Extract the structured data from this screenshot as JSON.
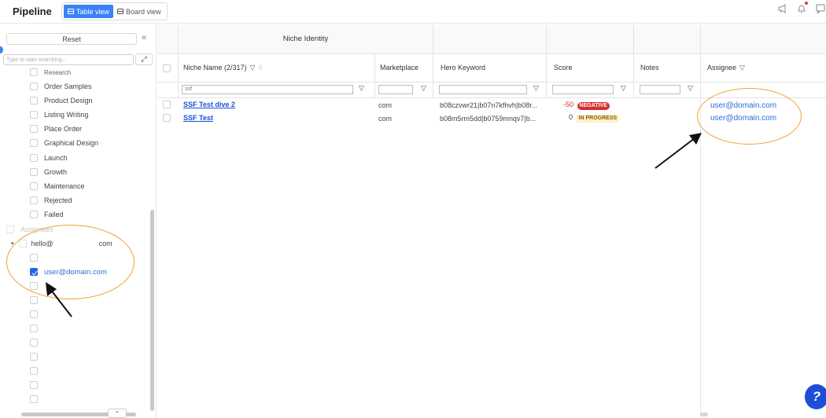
{
  "header": {
    "title": "Pipeline",
    "views": [
      {
        "label": "Table view",
        "active": true,
        "icon": "table-icon"
      },
      {
        "label": "Board view",
        "active": false,
        "icon": "board-icon"
      }
    ],
    "icons": [
      "megaphone-icon",
      "bell-icon",
      "chat-icon"
    ]
  },
  "sidebar": {
    "reset_label": "Reset",
    "collapse_glyph": "«",
    "search_placeholder": "Type to start searching...",
    "expand_glyph": "⤢",
    "stages": [
      {
        "label": "Research",
        "checked": false,
        "partial": true
      },
      {
        "label": "Order Samples",
        "checked": false
      },
      {
        "label": "Product Design",
        "checked": false
      },
      {
        "label": "Listing Writing",
        "checked": false
      },
      {
        "label": "Place Order",
        "checked": false
      },
      {
        "label": "Graphical Design",
        "checked": false
      },
      {
        "label": "Launch",
        "checked": false
      },
      {
        "label": "Growth",
        "checked": false
      },
      {
        "label": "Maintenance",
        "checked": false
      },
      {
        "label": "Rejected",
        "checked": false
      },
      {
        "label": "Failed",
        "checked": false
      }
    ],
    "assignees_label": "Assignees",
    "assignee_group": {
      "label_prefix": "hello@",
      "label_suffix": "com"
    },
    "assignees": [
      {
        "label": "",
        "checked": false
      },
      {
        "label": "user@domain.com",
        "checked": true
      },
      {
        "label": "",
        "checked": false
      },
      {
        "label": "",
        "checked": false
      },
      {
        "label": "",
        "checked": false
      },
      {
        "label": "",
        "checked": false
      },
      {
        "label": "",
        "checked": false
      },
      {
        "label": "",
        "checked": false
      },
      {
        "label": "",
        "checked": false
      },
      {
        "label": "",
        "checked": false
      },
      {
        "label": "",
        "checked": false
      }
    ],
    "scroll_up_glyph": "⌃"
  },
  "table": {
    "group_header": "Niche Identity",
    "columns": [
      {
        "label": "Niche Name (2/317)",
        "suffix": "▽ ♢"
      },
      {
        "label": "Marketplace",
        "suffix": ""
      },
      {
        "label": "Hero Keyword",
        "suffix": ""
      },
      {
        "label": "Score",
        "suffix": ""
      },
      {
        "label": "Notes",
        "suffix": ""
      },
      {
        "label": "Assignee",
        "suffix": "▽"
      }
    ],
    "filters": {
      "niche_name": "ssf",
      "marketplace": "",
      "hero_keyword": "",
      "score": "",
      "notes": ""
    },
    "filter_glyph": "▽",
    "rows": [
      {
        "name": "SSF Test dive 2",
        "marketplace": "com",
        "hero_keyword": "b08czvwr21|b07n7kfhvh|b08r...",
        "score": "-50",
        "status": "NEGATIVE",
        "status_color": "#d32f2f",
        "status_text_color": "#ffffff",
        "notes": "",
        "assignee": "user@domain.com"
      },
      {
        "name": "SSF Test",
        "marketplace": "com",
        "hero_keyword": "b08m5rm5dd|b0759mnqv7|b...",
        "score": "0",
        "status": "IN PROGRESS",
        "status_color": "#fdf1c7",
        "status_text_color": "#8a5a00",
        "notes": "",
        "assignee": "user@domain.com"
      }
    ]
  },
  "help_glyph": "?",
  "colors": {
    "accent": "#3b82f6",
    "highlight": "#f0a030",
    "link": "#1d4ed8"
  }
}
